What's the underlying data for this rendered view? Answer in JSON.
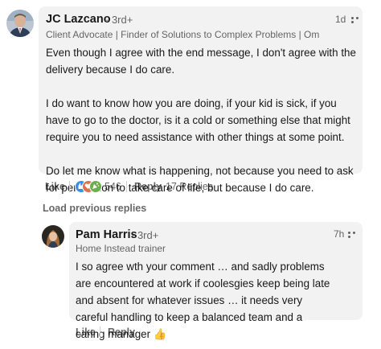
{
  "comment": {
    "author_name": "JC Lazcano",
    "degree": "· 3rd+",
    "headline": "Client Advocate | Finder of Solutions to Complex Problems | Omnivert...",
    "time": "1d",
    "paragraphs": [
      "Even though I agree with the end message, I don't agree with the delivery because I do care.",
      "I do want to know how you are doing, if your kid is sick, if you have to go to the doctor, is it a cold or something else that might require you to need assistance with other things at some point.",
      "Do let me know what is happening, not because you need to ask for permission to take care of life, but because I do care."
    ],
    "like_label": "Like",
    "reaction_count": "546",
    "reply_label": "Reply",
    "replies_count": "17 Replies",
    "reaction_icons": [
      "thumbs-up-icon",
      "heart-icon",
      "celebrate-icon"
    ],
    "reaction_colors": [
      "#378fe9",
      "#df704d",
      "#6dae4f"
    ]
  },
  "load_previous_label": "Load previous replies",
  "reply": {
    "author_name": "Pam Harris",
    "degree": "· 3rd+",
    "headline": "Home Instead trainer",
    "time": "7h",
    "text": "I so agree wth your comment … and sadly problems are encountered at work if coolesgies keep being late and absent for whatever issues … it needs very careful handling to keep a balanced team and a caring manager 👍",
    "like_label": "Like",
    "reply_label": "Reply"
  },
  "colors": {
    "bubble": "#f2f2f2",
    "secondary_text": "#666666",
    "primary_text": "#191919"
  }
}
